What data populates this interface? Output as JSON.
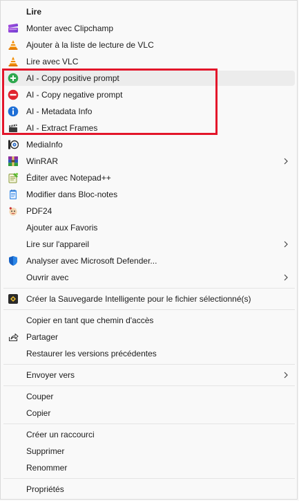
{
  "menu": {
    "items": [
      {
        "label": "Lire",
        "bold": true
      },
      {
        "label": "Monter avec Clipchamp",
        "icon": "clipchamp-icon"
      },
      {
        "label": "Ajouter à la liste de lecture de VLC",
        "icon": "vlc-icon"
      },
      {
        "label": "Lire avec VLC",
        "icon": "vlc-icon"
      },
      {
        "label": "AI - Copy positive prompt",
        "icon": "plus-circle-icon"
      },
      {
        "label": "AI - Copy negative prompt",
        "icon": "minus-circle-icon"
      },
      {
        "label": "AI - Metadata Info",
        "icon": "info-circle-icon"
      },
      {
        "label": "AI - Extract Frames",
        "icon": "clapperboard-icon"
      },
      {
        "label": "MediaInfo",
        "icon": "mediainfo-icon"
      },
      {
        "label": "WinRAR",
        "icon": "winrar-icon",
        "submenu": true
      },
      {
        "label": "Éditer avec Notepad++",
        "icon": "notepadpp-icon"
      },
      {
        "label": "Modifier dans Bloc-notes",
        "icon": "notepad-icon"
      },
      {
        "label": "PDF24",
        "icon": "pdf24-icon"
      },
      {
        "label": "Ajouter aux Favoris"
      },
      {
        "label": "Lire sur l'appareil",
        "submenu": true
      },
      {
        "label": "Analyser avec Microsoft Defender...",
        "icon": "defender-shield-icon"
      },
      {
        "label": "Ouvrir avec",
        "submenu": true
      },
      {
        "label": "Créer la Sauvegarde Intelligente pour le fichier sélectionné(s)",
        "icon": "smart-backup-icon"
      },
      {
        "label": "Copier en tant que chemin d'accès"
      },
      {
        "label": "Partager",
        "icon": "share-icon"
      },
      {
        "label": "Restaurer les versions précédentes"
      },
      {
        "label": "Envoyer vers",
        "submenu": true
      },
      {
        "label": "Couper"
      },
      {
        "label": "Copier"
      },
      {
        "label": "Créer un raccourci"
      },
      {
        "label": "Supprimer"
      },
      {
        "label": "Renommer"
      },
      {
        "label": "Propriétés"
      }
    ]
  },
  "colors": {
    "highlight_border": "#e3152a",
    "plus_green": "#2fa84f",
    "minus_red": "#e0242f",
    "info_blue": "#1f6fd6",
    "vlc_orange": "#f08a00",
    "defender_blue": "#1560c4"
  }
}
